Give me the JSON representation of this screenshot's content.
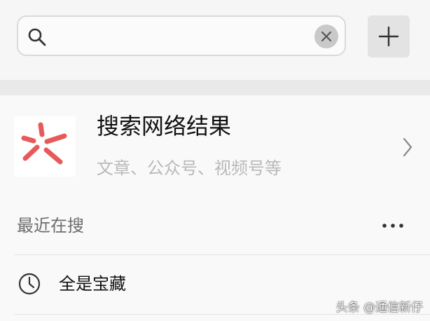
{
  "search": {
    "value": "",
    "placeholder": ""
  },
  "result": {
    "title": "搜索网络结果",
    "subtitle": "文章、公众号、视频号等"
  },
  "recent": {
    "label": "最近在搜",
    "items": [
      {
        "text": "全是宝藏"
      }
    ]
  },
  "watermark": "头条 @通信新仔",
  "colors": {
    "logo_accent": "#e85a5a",
    "background": "#f6f6f6",
    "band": "#e9e9e9"
  },
  "icons": {
    "search": "search-icon",
    "clear": "close-icon",
    "add": "plus-icon",
    "chevron": "chevron-right-icon",
    "more": "more-icon",
    "history": "clock-icon"
  }
}
